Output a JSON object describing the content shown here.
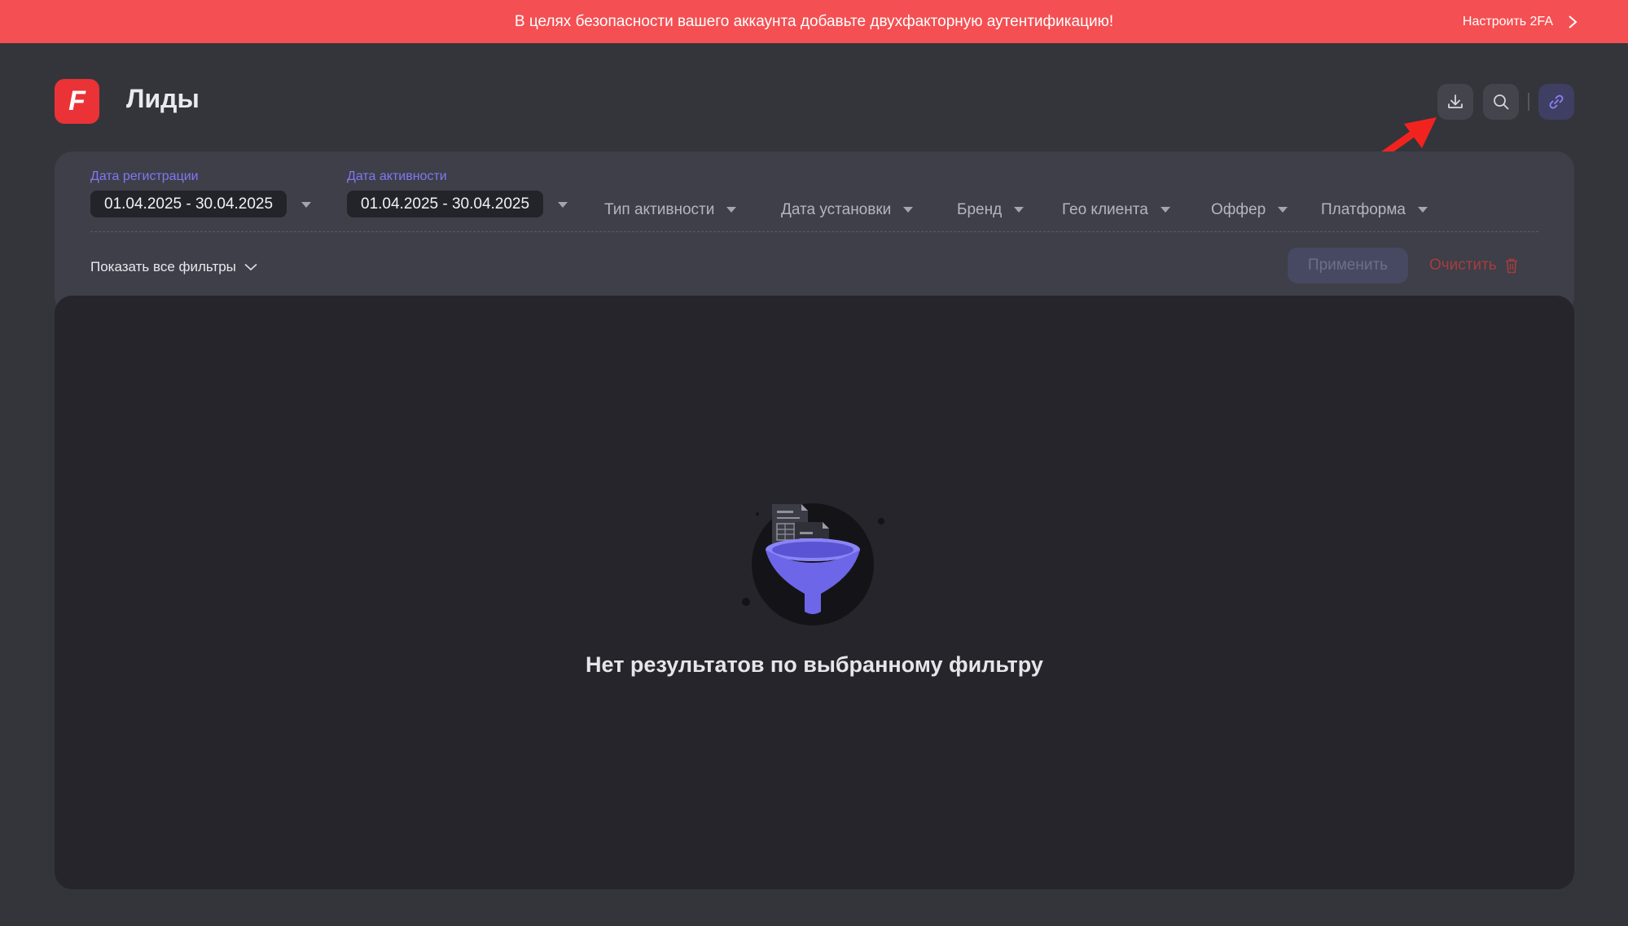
{
  "banner": {
    "message": "В целях безопасности вашего аккаунта добавьте двухфакторную аутентификацию!",
    "action_label": "Настроить 2FA",
    "color": "#f44f52"
  },
  "header": {
    "logo_letter": "F",
    "title": "Лиды",
    "actions": [
      {
        "name": "download",
        "icon": "download-icon"
      },
      {
        "name": "search",
        "icon": "search-icon"
      },
      {
        "name": "link",
        "icon": "link-icon"
      }
    ]
  },
  "filters": {
    "registration_date": {
      "label": "Дата регистрации",
      "value": "01.04.2025 - 30.04.2025"
    },
    "activity_date": {
      "label": "Дата активности",
      "value": "01.04.2025 - 30.04.2025"
    },
    "dropdowns": [
      "Тип активности",
      "Дата установки",
      "Бренд",
      "Гео клиента",
      "Оффер",
      "Платформа"
    ],
    "show_all_label": "Показать все фильтры",
    "apply_label": "Применить",
    "clear_label": "Очистить"
  },
  "results": {
    "empty_message": "Нет результатов по выбранному фильтру",
    "illustration": "funnel-documents-icon"
  },
  "colors": {
    "accent": "#7f78f3",
    "danger": "#a73c3f",
    "brand": "#ea3237"
  }
}
